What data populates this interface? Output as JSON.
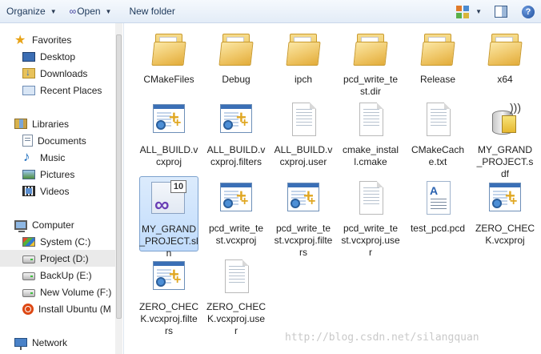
{
  "toolbar": {
    "organize_label": "Organize",
    "open_label": "Open",
    "new_folder_label": "New folder",
    "help_glyph": "?"
  },
  "nav": {
    "items": [
      {
        "label": "Favorites",
        "icon": "star-icon"
      },
      {
        "label": "Desktop",
        "icon": "desktop-icon"
      },
      {
        "label": "Downloads",
        "icon": "downloads-icon"
      },
      {
        "label": "Recent Places",
        "icon": "recent-places-icon"
      },
      {
        "label": "Libraries",
        "icon": "libraries-icon"
      },
      {
        "label": "Documents",
        "icon": "documents-icon"
      },
      {
        "label": "Music",
        "icon": "music-icon"
      },
      {
        "label": "Pictures",
        "icon": "pictures-icon"
      },
      {
        "label": "Videos",
        "icon": "videos-icon"
      },
      {
        "label": "Computer",
        "icon": "computer-icon"
      },
      {
        "label": "System (C:)",
        "icon": "system-drive-icon"
      },
      {
        "label": "Project (D:)",
        "icon": "drive-icon",
        "selected": true
      },
      {
        "label": "BackUp (E:)",
        "icon": "drive-icon"
      },
      {
        "label": "New Volume (F:)",
        "icon": "drive-icon"
      },
      {
        "label": "Install Ubuntu (M",
        "icon": "ubuntu-icon"
      },
      {
        "label": "Network",
        "icon": "network-icon"
      }
    ]
  },
  "files": [
    {
      "name": "CMakeFiles",
      "type": "folder"
    },
    {
      "name": "Debug",
      "type": "folder"
    },
    {
      "name": "ipch",
      "type": "folder"
    },
    {
      "name": "pcd_write_test.dir",
      "type": "folder"
    },
    {
      "name": "Release",
      "type": "folder"
    },
    {
      "name": "x64",
      "type": "folder"
    },
    {
      "name": "ALL_BUILD.vcxproj",
      "type": "vcxproj"
    },
    {
      "name": "ALL_BUILD.vcxproj.filters",
      "type": "vcxproj"
    },
    {
      "name": "ALL_BUILD.vcxproj.user",
      "type": "file"
    },
    {
      "name": "cmake_install.cmake",
      "type": "file"
    },
    {
      "name": "CMakeCache.txt",
      "type": "file"
    },
    {
      "name": "MY_GRAND_PROJECT.sdf",
      "type": "sdf"
    },
    {
      "name": "MY_GRAND_PROJECT.sln",
      "type": "sln",
      "selected": true
    },
    {
      "name": "pcd_write_test.vcxproj",
      "type": "vcxproj"
    },
    {
      "name": "pcd_write_test.vcxproj.filters",
      "type": "vcxproj"
    },
    {
      "name": "pcd_write_test.vcxproj.user",
      "type": "file"
    },
    {
      "name": "test_pcd.pcd",
      "type": "pcd"
    },
    {
      "name": "ZERO_CHECK.vcxproj",
      "type": "vcxproj"
    },
    {
      "name": "ZERO_CHECK.vcxproj.filters",
      "type": "vcxproj"
    },
    {
      "name": "ZERO_CHECK.vcxproj.user",
      "type": "file"
    }
  ],
  "sln_badge": "10",
  "watermark": "http://blog.csdn.net/silangquan"
}
